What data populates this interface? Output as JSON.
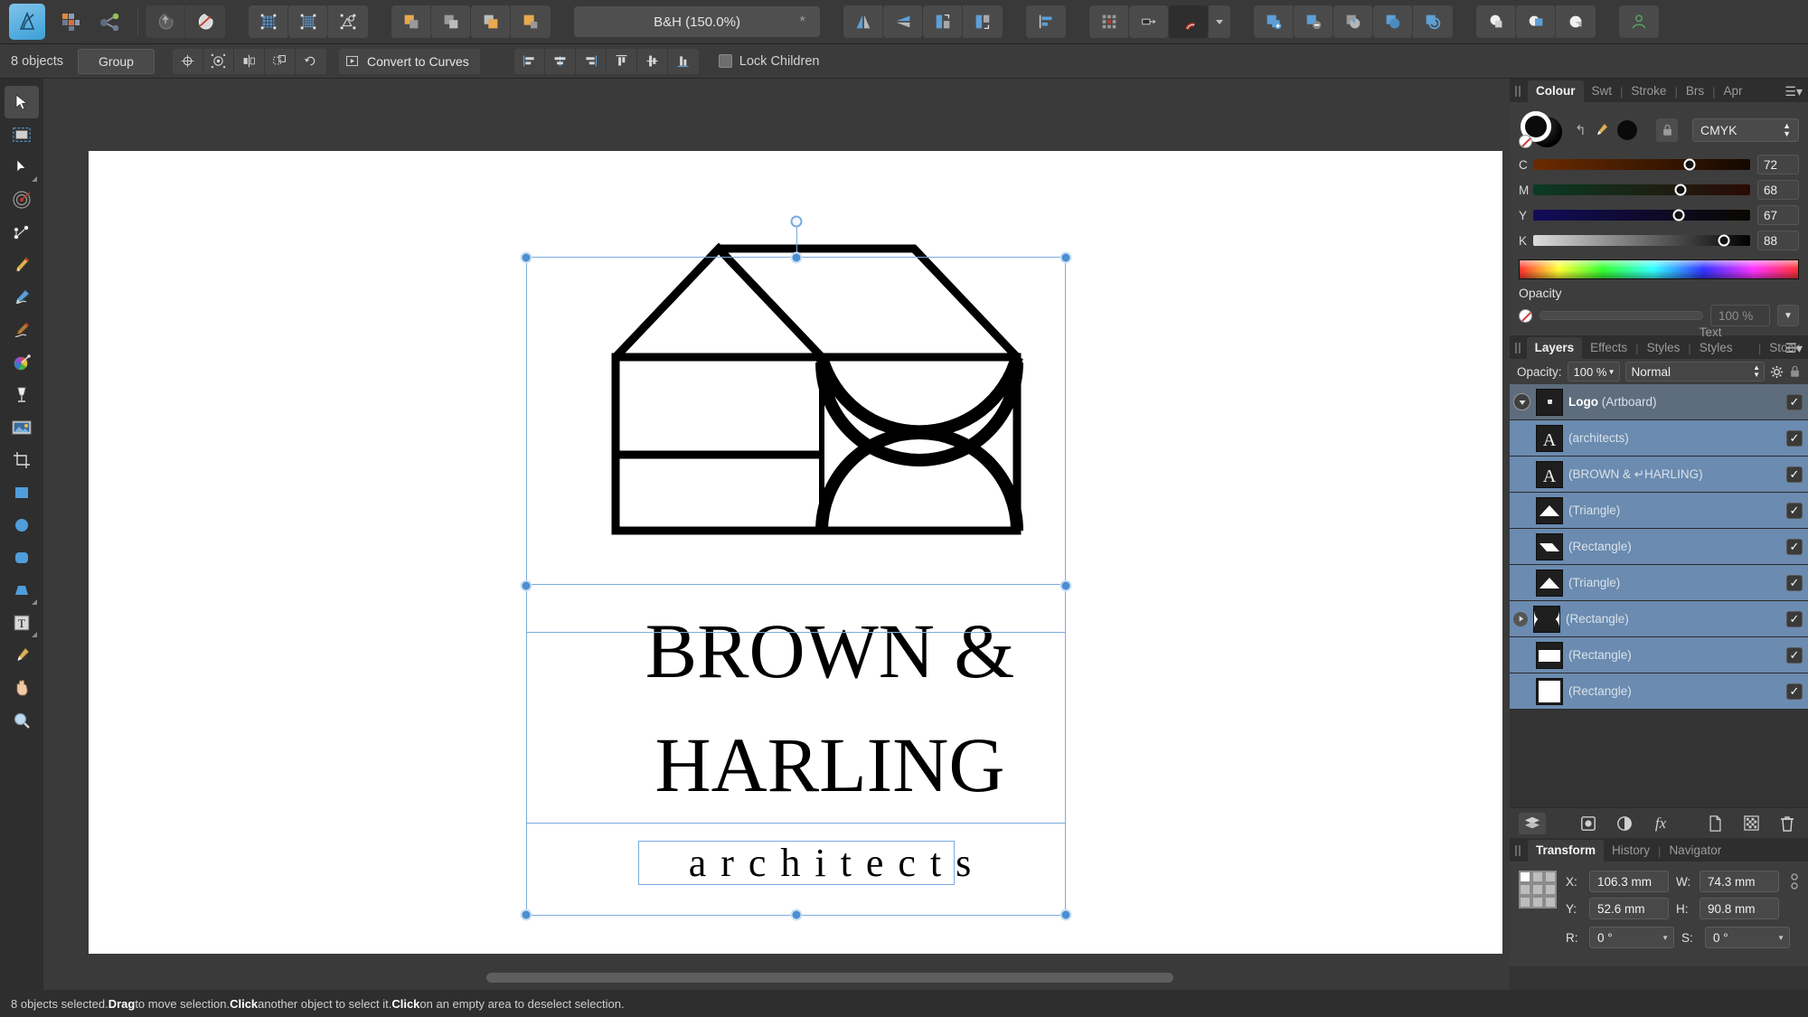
{
  "app": {
    "name": "Affinity Designer",
    "document_title": "B&H (150.0%)",
    "modified_marker": "*"
  },
  "toolbar": {
    "icons": [
      {
        "name": "app-logo-icon",
        "label": "Affinity Designer"
      },
      {
        "name": "pixel-persona-icon",
        "label": "Pixel Persona"
      },
      {
        "name": "export-persona-icon",
        "label": "Export Persona"
      },
      {
        "name": "undo-icon",
        "label": "Undo"
      },
      {
        "name": "redo-icon",
        "label": "Redo"
      },
      {
        "name": "show-grid-icon",
        "label": "Show Grid"
      },
      {
        "name": "snapping-grid-icon",
        "label": "Grid and Axis"
      },
      {
        "name": "pixel-preview-icon",
        "label": "Pixel Preview"
      },
      {
        "name": "move-to-front-icon",
        "label": "Move to Front"
      },
      {
        "name": "move-forward-icon",
        "label": "Move Forward"
      },
      {
        "name": "move-backward-icon",
        "label": "Move Backward"
      },
      {
        "name": "move-to-back-icon",
        "label": "Move to Back"
      },
      {
        "name": "flip-horizontal-icon",
        "label": "Flip Horizontal"
      },
      {
        "name": "flip-vertical-icon",
        "label": "Flip Vertical"
      },
      {
        "name": "rotate-left-icon",
        "label": "Rotate Left"
      },
      {
        "name": "rotate-right-icon",
        "label": "Rotate Right"
      },
      {
        "name": "alignment-icon",
        "label": "Alignment"
      },
      {
        "name": "grid-snapping-icon",
        "label": "Grid Options"
      },
      {
        "name": "snapping-candidates-icon",
        "label": "Snapping"
      },
      {
        "name": "magnet-icon",
        "label": "Enable Snapping"
      },
      {
        "name": "snapping-dropdown-icon",
        "label": "Snapping Options"
      },
      {
        "name": "boolean-add-icon",
        "label": "Add"
      },
      {
        "name": "boolean-subtract-icon",
        "label": "Subtract"
      },
      {
        "name": "boolean-intersect-icon",
        "label": "Intersect"
      },
      {
        "name": "boolean-divide-icon",
        "label": "Divide"
      },
      {
        "name": "boolean-combine-icon",
        "label": "Combine"
      },
      {
        "name": "geometry-union-icon",
        "label": "Union"
      },
      {
        "name": "geometry-merge-icon",
        "label": "Merge"
      },
      {
        "name": "geometry-separate-icon",
        "label": "Separate"
      },
      {
        "name": "account-icon",
        "label": "Account"
      }
    ]
  },
  "context_bar": {
    "object_count": "8 objects",
    "group_button": "Group",
    "convert_to_curves": "Convert to Curves",
    "lock_children": "Lock Children",
    "lock_children_checked": false,
    "icon_buttons": [
      {
        "name": "rotation-center-icon",
        "label": "Show Rotation Center"
      },
      {
        "name": "hide-selection-icon",
        "label": "Hide Selection"
      },
      {
        "name": "mirror-icon",
        "label": "Mirror"
      },
      {
        "name": "transform-objects-separately-icon",
        "label": "Transform Separately"
      },
      {
        "name": "reset-rotation-icon",
        "label": "Reset Rotation"
      }
    ],
    "align_buttons": [
      {
        "name": "align-left-icon",
        "label": "Align Left"
      },
      {
        "name": "align-center-horizontal-icon",
        "label": "Align Center"
      },
      {
        "name": "align-right-icon",
        "label": "Align Right"
      },
      {
        "name": "align-top-icon",
        "label": "Align Top"
      },
      {
        "name": "align-middle-vertical-icon",
        "label": "Align Middle"
      },
      {
        "name": "align-bottom-icon",
        "label": "Align Bottom"
      }
    ]
  },
  "tools": [
    {
      "name": "move-tool",
      "label": "Move Tool",
      "selected": true,
      "glyph": "arrow"
    },
    {
      "name": "artboard-tool",
      "label": "Artboard Tool",
      "selected": false,
      "glyph": "artboard"
    },
    {
      "name": "node-tool",
      "label": "Node Tool",
      "selected": false,
      "glyph": "node"
    },
    {
      "name": "corner-tool",
      "label": "Corner Tool",
      "selected": false,
      "glyph": "corner"
    },
    {
      "name": "pen-node-tool",
      "label": "Point Transform Tool",
      "selected": false,
      "glyph": "transform"
    },
    {
      "name": "pen-tool",
      "label": "Pen Tool",
      "selected": false,
      "glyph": "pen"
    },
    {
      "name": "pencil-tool",
      "label": "Pencil Tool",
      "selected": false,
      "glyph": "pencil"
    },
    {
      "name": "vector-brush-tool",
      "label": "Vector Brush Tool",
      "selected": false,
      "glyph": "brush"
    },
    {
      "name": "fill-tool",
      "label": "Fill Tool",
      "selected": false,
      "glyph": "colorwheel"
    },
    {
      "name": "transparency-tool",
      "label": "Transparency Tool",
      "selected": false,
      "glyph": "glass"
    },
    {
      "name": "place-image-tool",
      "label": "Place Image Tool",
      "selected": false,
      "glyph": "image"
    },
    {
      "name": "crop-tool",
      "label": "Crop Tool",
      "selected": false,
      "glyph": "crop"
    },
    {
      "name": "rectangle-tool",
      "label": "Rectangle Tool",
      "selected": false,
      "glyph": "rect"
    },
    {
      "name": "ellipse-tool",
      "label": "Ellipse Tool",
      "selected": false,
      "glyph": "ellipse"
    },
    {
      "name": "rounded-rectangle-tool",
      "label": "Rounded Rectangle Tool",
      "selected": false,
      "glyph": "roundrect"
    },
    {
      "name": "trapezoid-tool",
      "label": "Trapezoid Tool",
      "selected": false,
      "glyph": "trapezoid"
    },
    {
      "name": "artistic-text-tool",
      "label": "Artistic Text Tool",
      "selected": false,
      "glyph": "text"
    },
    {
      "name": "color-picker-tool",
      "label": "Colour Picker Tool",
      "selected": false,
      "glyph": "dropper"
    },
    {
      "name": "view-pan-tool",
      "label": "View Tool",
      "selected": false,
      "glyph": "hand"
    },
    {
      "name": "zoom-tool",
      "label": "Zoom Tool",
      "selected": false,
      "glyph": "zoom"
    }
  ],
  "artwork": {
    "line1": "BROWN &",
    "line2": "HARLING",
    "tagline": "architects",
    "stroke_color": "#000000"
  },
  "colour_panel": {
    "tabs": [
      {
        "name": "tab-colour",
        "label": "Colour",
        "active": true
      },
      {
        "name": "tab-swatches",
        "label": "Swt",
        "active": false
      },
      {
        "name": "tab-stroke",
        "label": "Stroke",
        "active": false
      },
      {
        "name": "tab-brushes",
        "label": "Brs",
        "active": false
      },
      {
        "name": "tab-appearance",
        "label": "Apr",
        "active": false
      }
    ],
    "model": "CMYK",
    "sliders": [
      {
        "name": "slider-cyan",
        "label": "C",
        "value": "72",
        "pct": 72,
        "grad_from": "#6b2b00",
        "grad_to": "#140800"
      },
      {
        "name": "slider-magenta",
        "label": "M",
        "value": "68",
        "pct": 68,
        "grad_from": "#0a3b23",
        "grad_to": "#2b0a05"
      },
      {
        "name": "slider-yellow",
        "label": "Y",
        "value": "67",
        "pct": 67,
        "grad_from": "#120c5a",
        "grad_to": "#0a0800"
      },
      {
        "name": "slider-black",
        "label": "K",
        "value": "88",
        "pct": 88,
        "grad_from": "#dcdcdc",
        "grad_to": "#000000"
      }
    ],
    "opacity_label": "Opacity",
    "opacity_value": "100 %"
  },
  "layers_panel": {
    "tabs": [
      {
        "name": "tab-layers",
        "label": "Layers",
        "active": true
      },
      {
        "name": "tab-effects",
        "label": "Effects",
        "active": false
      },
      {
        "name": "tab-styles",
        "label": "Styles",
        "active": false
      },
      {
        "name": "tab-text-styles",
        "label": "Text Styles",
        "active": false
      },
      {
        "name": "tab-stock",
        "label": "Stock",
        "active": false
      }
    ],
    "opacity_label": "Opacity:",
    "opacity_value": "100 %",
    "blend_mode": "Normal",
    "rows": [
      {
        "name": "layer-row-logo",
        "label": "Logo",
        "suffix": "(Artboard)",
        "thumb": "artboard",
        "kind": "artboard",
        "selected": false,
        "visible": true,
        "expandable": true,
        "expanded": true,
        "indent": 0
      },
      {
        "name": "layer-row-architects",
        "label": "",
        "suffix": "(architects)",
        "thumb": "text",
        "kind": "text",
        "selected": true,
        "visible": true,
        "expandable": false,
        "indent": 1
      },
      {
        "name": "layer-row-brown-harling",
        "label": "",
        "suffix": "(BROWN & ↵HARLING)",
        "thumb": "text",
        "kind": "text",
        "selected": true,
        "visible": true,
        "expandable": false,
        "indent": 1
      },
      {
        "name": "layer-row-triangle-1",
        "label": "",
        "suffix": "(Triangle)",
        "thumb": "triangle",
        "kind": "shape",
        "selected": true,
        "visible": true,
        "expandable": false,
        "indent": 1
      },
      {
        "name": "layer-row-rectangle-1",
        "label": "",
        "suffix": "(Rectangle)",
        "thumb": "slant",
        "kind": "shape",
        "selected": true,
        "visible": true,
        "expandable": false,
        "indent": 1
      },
      {
        "name": "layer-row-triangle-2",
        "label": "",
        "suffix": "(Triangle)",
        "thumb": "triangle",
        "kind": "shape",
        "selected": true,
        "visible": true,
        "expandable": false,
        "indent": 1
      },
      {
        "name": "layer-row-rectangle-2",
        "label": "",
        "suffix": "(Rectangle)",
        "thumb": "hourglass",
        "kind": "shape",
        "selected": true,
        "visible": true,
        "expandable": true,
        "expanded": false,
        "indent": 1
      },
      {
        "name": "layer-row-rectangle-3",
        "label": "",
        "suffix": "(Rectangle)",
        "thumb": "band",
        "kind": "shape",
        "selected": true,
        "visible": true,
        "expandable": false,
        "indent": 1
      },
      {
        "name": "layer-row-rectangle-4",
        "label": "",
        "suffix": "(Rectangle)",
        "thumb": "white",
        "kind": "shape",
        "selected": true,
        "visible": true,
        "expandable": false,
        "indent": 1
      }
    ],
    "toolbar_icons": [
      {
        "name": "layers-stack-icon",
        "label": "Layers"
      },
      {
        "name": "mask-layer-icon",
        "label": "Mask Layer"
      },
      {
        "name": "adjustment-layer-icon",
        "label": "Adjustment Layer"
      },
      {
        "name": "layer-effects-icon",
        "label": "Layer Effects"
      },
      {
        "name": "add-layer-icon",
        "label": "Add Layer"
      },
      {
        "name": "add-pixel-layer-icon",
        "label": "Add Pixel Layer"
      },
      {
        "name": "delete-layer-icon",
        "label": "Delete Layer"
      }
    ]
  },
  "transform_panel": {
    "tabs": [
      {
        "name": "tab-transform",
        "label": "Transform",
        "active": true
      },
      {
        "name": "tab-history",
        "label": "History",
        "active": false
      },
      {
        "name": "tab-navigator",
        "label": "Navigator",
        "active": false
      }
    ],
    "fields": {
      "x_label": "X:",
      "x_value": "106.3 mm",
      "y_label": "Y:",
      "y_value": "52.6 mm",
      "w_label": "W:",
      "w_value": "74.3 mm",
      "h_label": "H:",
      "h_value": "90.8 mm",
      "r_label": "R:",
      "r_value": "0 °",
      "s_label": "S:",
      "s_value": "0 °"
    }
  },
  "status_bar": {
    "prefix": "8 objects selected. ",
    "b1": "Drag",
    "m1": " to move selection. ",
    "b2": "Click",
    "m2": " another object to select it. ",
    "b3": "Click",
    "m3": " on an empty area to deselect selection."
  }
}
